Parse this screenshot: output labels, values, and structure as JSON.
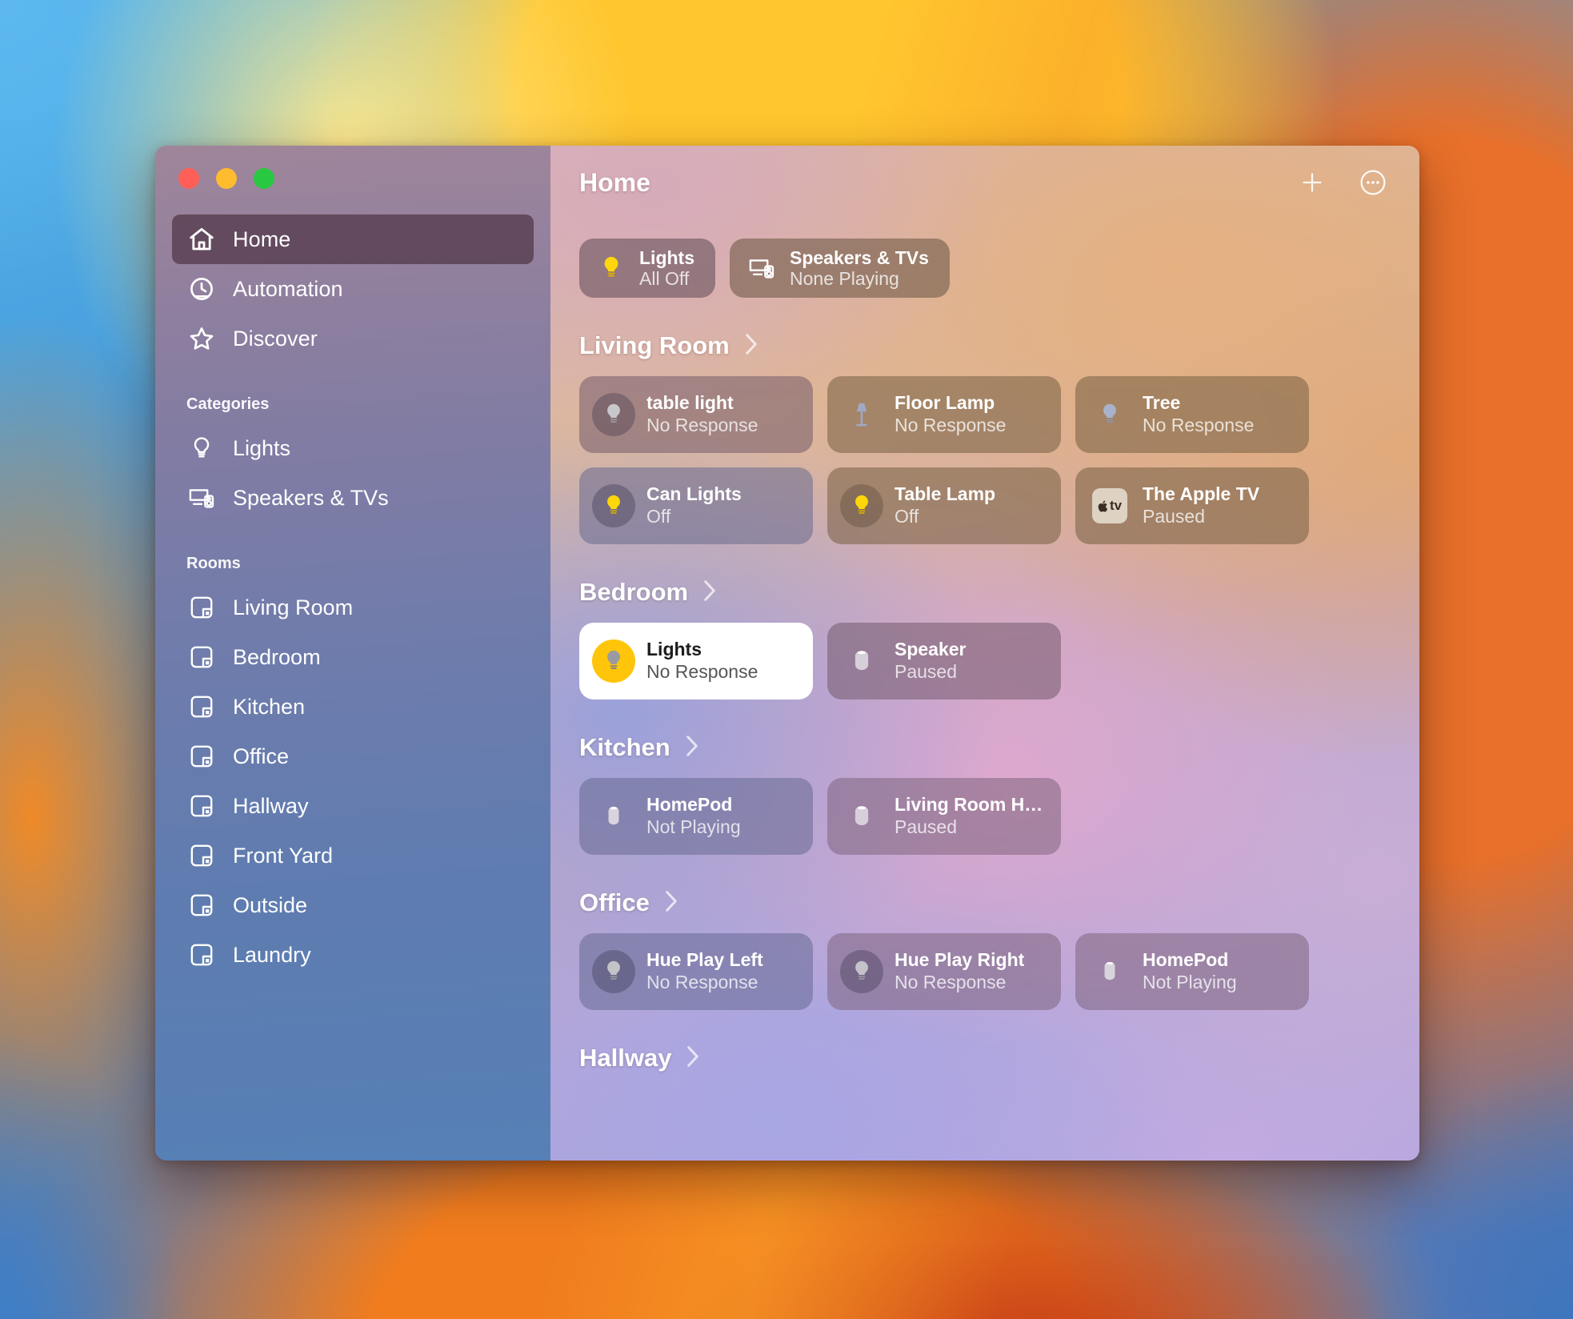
{
  "window": {
    "traffic_lights": [
      {
        "name": "close",
        "color": "#FF5F57"
      },
      {
        "name": "minimize",
        "color": "#FEBC2E"
      },
      {
        "name": "zoom",
        "color": "#28C840"
      }
    ]
  },
  "sidebar": {
    "nav": [
      {
        "label": "Home",
        "icon": "house-icon",
        "selected": true
      },
      {
        "label": "Automation",
        "icon": "clock-icon",
        "selected": false
      },
      {
        "label": "Discover",
        "icon": "star-icon",
        "selected": false
      }
    ],
    "categories_label": "Categories",
    "categories": [
      {
        "label": "Lights",
        "icon": "lightbulb-icon"
      },
      {
        "label": "Speakers & TVs",
        "icon": "tv-speaker-icon"
      }
    ],
    "rooms_label": "Rooms",
    "rooms": [
      {
        "label": "Living Room",
        "icon": "room-icon"
      },
      {
        "label": "Bedroom",
        "icon": "room-icon"
      },
      {
        "label": "Kitchen",
        "icon": "room-icon"
      },
      {
        "label": "Office",
        "icon": "room-icon"
      },
      {
        "label": "Hallway",
        "icon": "room-icon"
      },
      {
        "label": "Front Yard",
        "icon": "room-icon"
      },
      {
        "label": "Outside",
        "icon": "room-icon"
      },
      {
        "label": "Laundry",
        "icon": "room-icon"
      }
    ]
  },
  "header": {
    "title": "Home",
    "add_button": "add-icon",
    "more_button": "more-circle-icon"
  },
  "status_chips": [
    {
      "title": "Lights",
      "subtitle": "All Off",
      "icon": "lightbulb-on-icon"
    },
    {
      "title": "Speakers & TVs",
      "subtitle": "None Playing",
      "icon": "tv-speaker-icon"
    }
  ],
  "sections": [
    {
      "name": "Living Room",
      "tiles": [
        {
          "name": "table light",
          "state": "No Response",
          "icon": "bulb-off-icon",
          "style": "plum",
          "circle": "dark",
          "active": false
        },
        {
          "name": "Floor Lamp",
          "state": "No Response",
          "icon": "floor-lamp-icon",
          "style": "brown",
          "circle": "none",
          "active": false
        },
        {
          "name": "Tree",
          "state": "No Response",
          "icon": "bulb-off-icon",
          "style": "brown",
          "circle": "none",
          "active": false
        },
        {
          "name": "Can Lights",
          "state": "Off",
          "icon": "bulb-on-icon",
          "style": "blue",
          "circle": "dark",
          "active": false
        },
        {
          "name": "Table Lamp",
          "state": "Off",
          "icon": "bulb-on-icon",
          "style": "brown",
          "circle": "warm",
          "active": false
        },
        {
          "name": "The Apple TV",
          "state": "Paused",
          "icon": "apple-tv-icon",
          "style": "brown",
          "circle": "none",
          "active": false
        }
      ]
    },
    {
      "name": "Bedroom",
      "tiles": [
        {
          "name": "Lights",
          "state": "No Response",
          "icon": "bulb-off-icon",
          "style": "plum",
          "circle": "yellow",
          "active": true
        },
        {
          "name": "Speaker",
          "state": "Paused",
          "icon": "homepod-icon",
          "style": "plum",
          "circle": "none",
          "active": false
        }
      ]
    },
    {
      "name": "Kitchen",
      "tiles": [
        {
          "name": "HomePod",
          "state": "Not Playing",
          "icon": "homepod-icon",
          "style": "blue",
          "circle": "none",
          "active": false
        },
        {
          "name": "Living Room H…",
          "state": "Paused",
          "icon": "homepod-icon",
          "style": "mauve",
          "circle": "none",
          "active": false
        }
      ]
    },
    {
      "name": "Office",
      "tiles": [
        {
          "name": "Hue Play Left",
          "state": "No Response",
          "icon": "bulb-off-icon",
          "style": "blue",
          "circle": "dark",
          "active": false
        },
        {
          "name": "Hue Play Right",
          "state": "No Response",
          "icon": "bulb-off-icon",
          "style": "mauve",
          "circle": "dark",
          "active": false
        },
        {
          "name": "HomePod",
          "state": "Not Playing",
          "icon": "homepod-icon",
          "style": "mauve",
          "circle": "none",
          "active": false
        }
      ]
    },
    {
      "name": "Hallway",
      "tiles": []
    }
  ],
  "colors": {
    "accent_yellow": "#FFC50A",
    "active_tile_bg": "#FFFFFF",
    "sidebar_selected": "#462837"
  }
}
